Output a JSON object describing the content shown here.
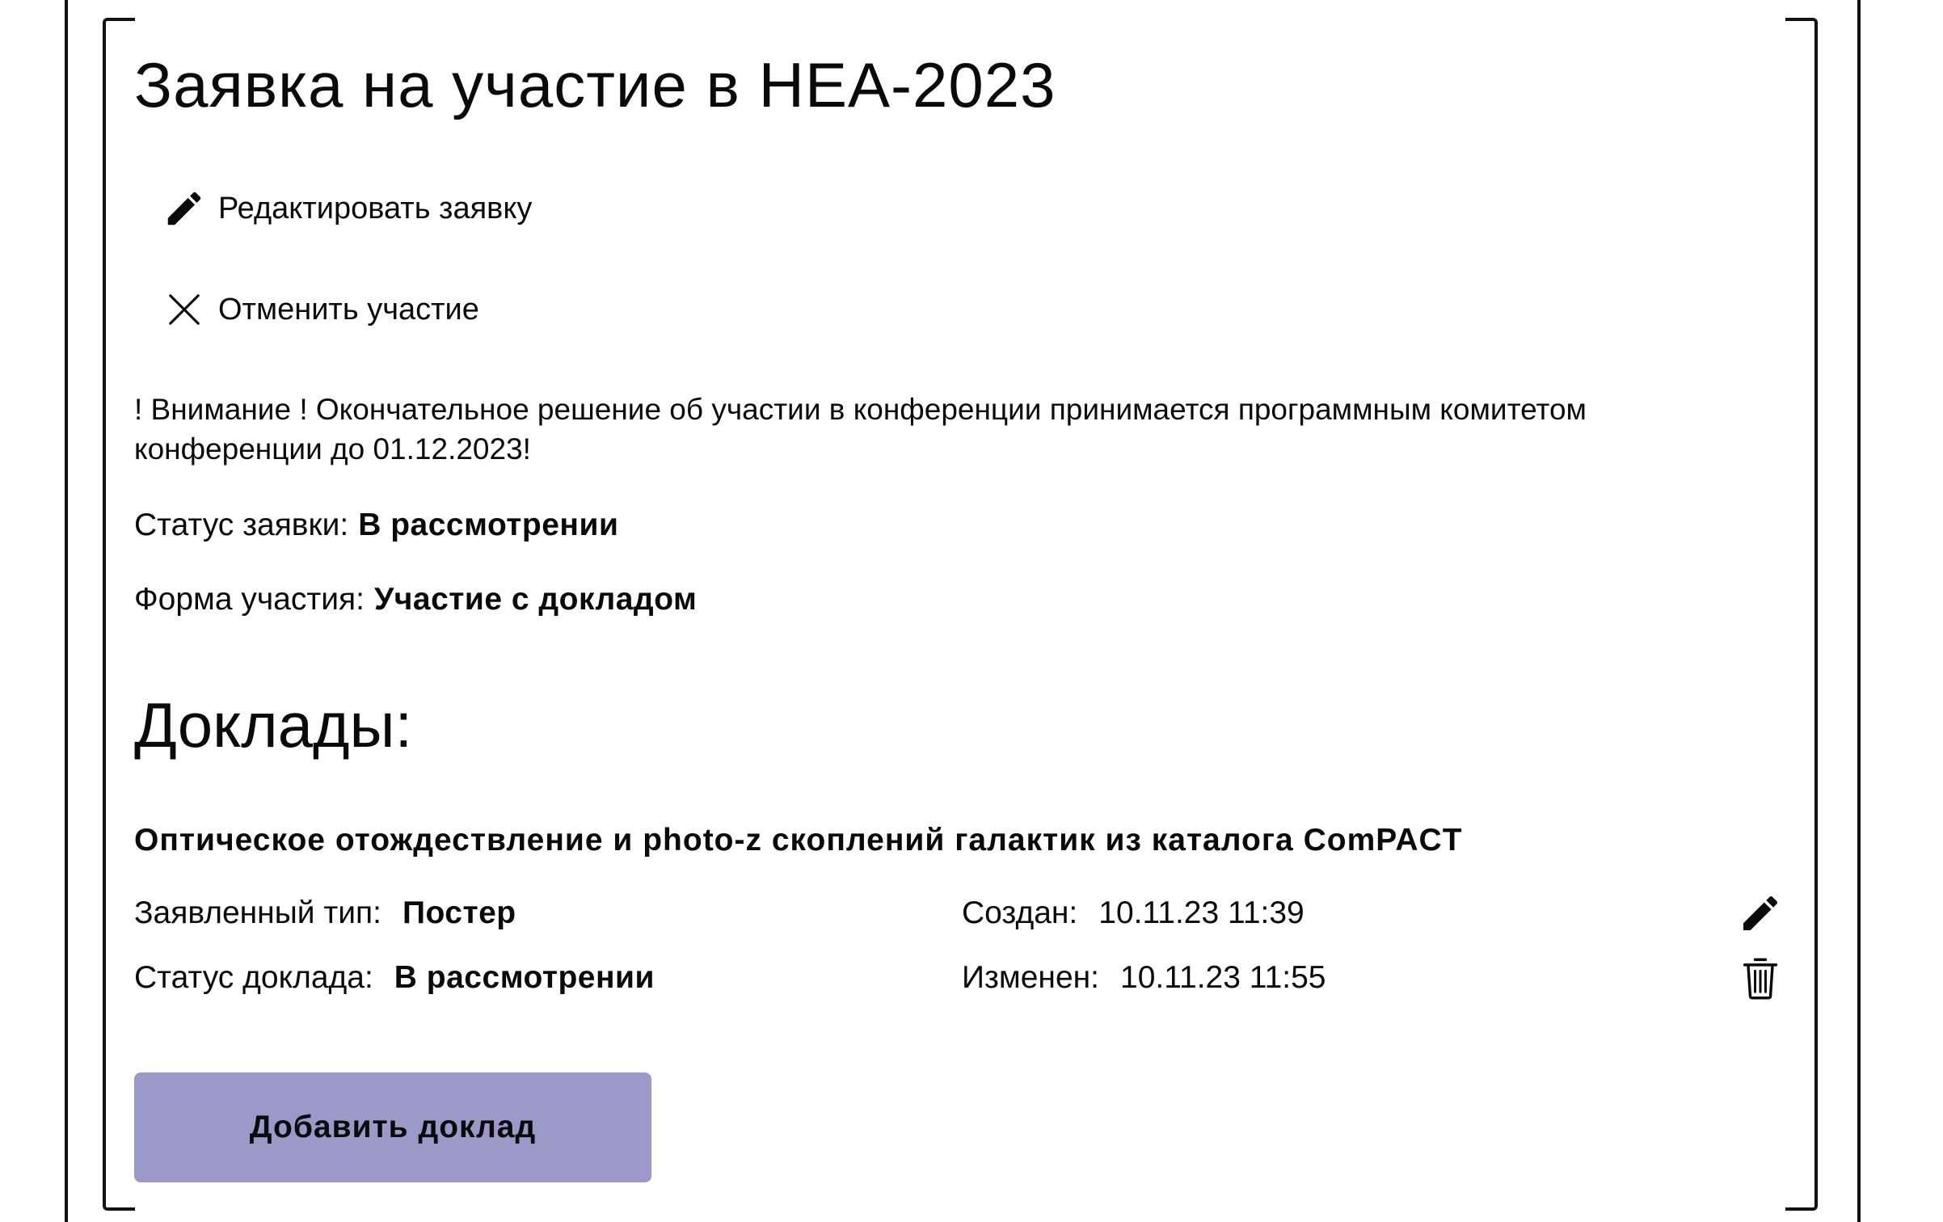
{
  "application": {
    "title": "Заявка на участие в НЕА-2023",
    "actions": {
      "edit_label": "Редактировать заявку",
      "cancel_label": "Отменить участие"
    },
    "notice": "! Внимание ! Окончательное решение об участии в конференции принимается программным комитетом конференции до 01.12.2023!",
    "status": {
      "label": "Статус заявки:",
      "value": "В рассмотрении"
    },
    "participation_form": {
      "label": "Форма участия:",
      "value": "Участие с докладом"
    }
  },
  "reports": {
    "heading": "Доклады:",
    "items": [
      {
        "title": "Оптическое отождествление и photo-z скоплений галактик из каталога ComPACT",
        "type_label": "Заявленный тип:",
        "type_value": "Постер",
        "status_label": "Статус доклада:",
        "status_value": "В рассмотрении",
        "created_label": "Создан:",
        "created_value": "10.11.23 11:39",
        "modified_label": "Изменен:",
        "modified_value": "10.11.23 11:55"
      }
    ],
    "add_button_label": "Добавить доклад"
  },
  "icons": {
    "edit": "pencil-icon",
    "cancel": "close-icon",
    "row_edit": "pencil-icon",
    "row_delete": "trash-icon"
  },
  "colors": {
    "add_button_bg": "#9c99c8",
    "frame": "#111111",
    "text": "#0a0a0a"
  }
}
